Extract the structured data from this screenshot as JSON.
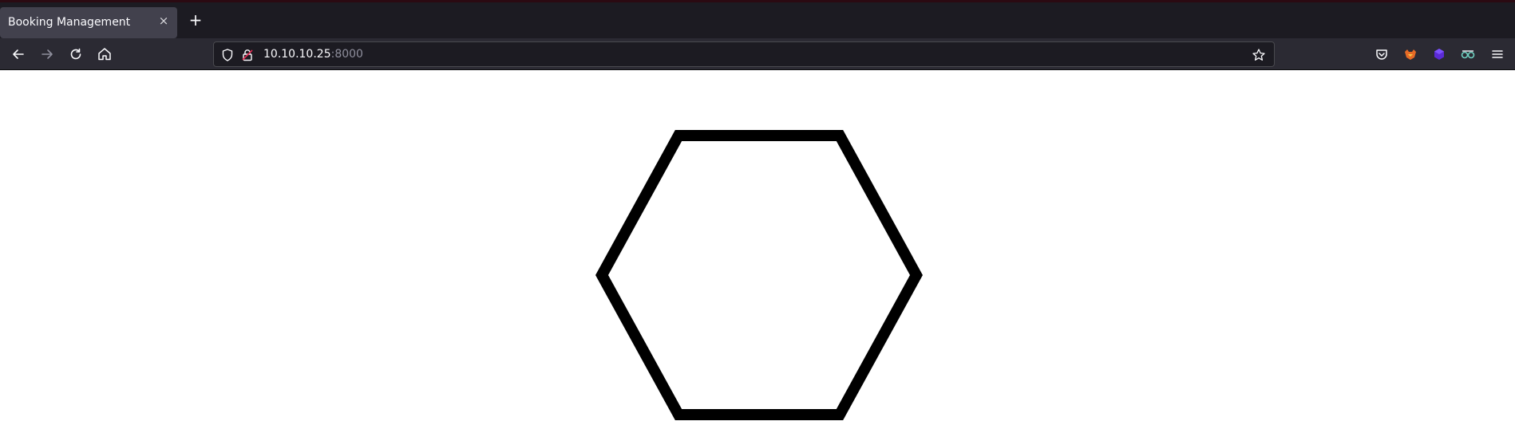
{
  "tab": {
    "title": "Booking Management",
    "close_label": "×"
  },
  "new_tab_label": "+",
  "urlbar": {
    "host": "10.10.10.25",
    "port": ":8000"
  },
  "icons": {
    "back": "arrow-left-icon",
    "forward": "arrow-right-icon",
    "reload": "reload-icon",
    "home": "home-icon",
    "shield": "shield-icon",
    "lock": "insecure-lock-icon",
    "bookmark": "star-icon",
    "pocket": "pocket-icon",
    "ext1": "fox-extension-icon",
    "ext2": "cube-extension-icon",
    "ext3": "glasses-extension-icon",
    "menu": "hamburger-menu-icon"
  },
  "colors": {
    "tabstrip_bg": "#1c1b22",
    "navbar_bg": "#2b2a33",
    "page_bg": "#ffffff",
    "hexagon_stroke": "#000000"
  }
}
